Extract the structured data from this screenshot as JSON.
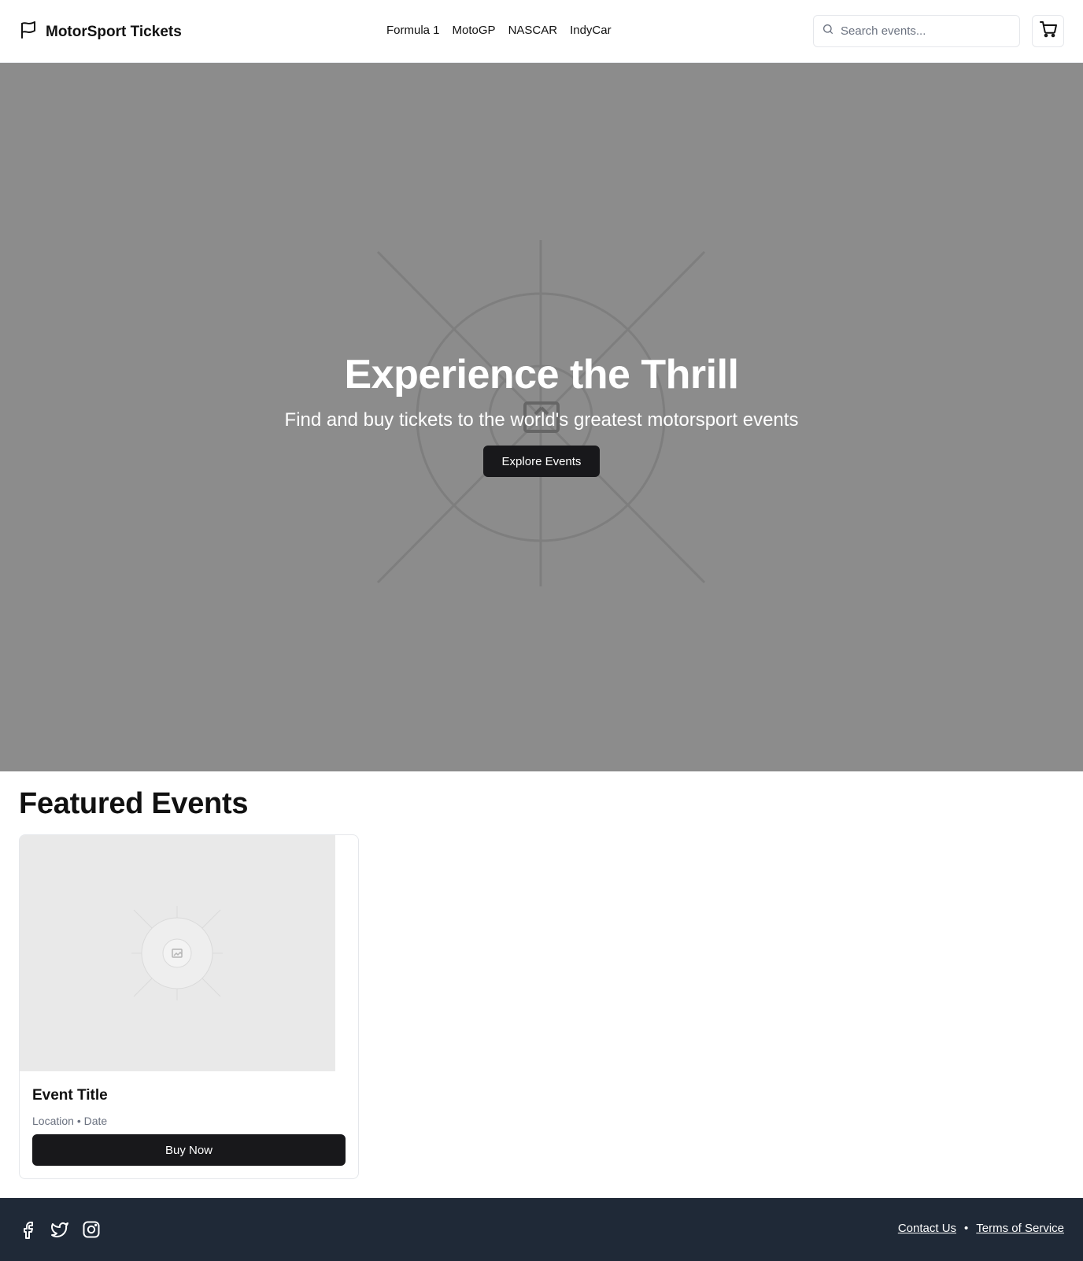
{
  "header": {
    "brand_name": "MotorSport Tickets",
    "brand_icon": "flag-icon",
    "nav": [
      "Formula 1",
      "MotoGP",
      "NASCAR",
      "IndyCar"
    ],
    "search_placeholder": "Search events...",
    "search_icon": "search-icon",
    "cart_icon": "cart-icon"
  },
  "hero": {
    "title": "Experience the Thrill",
    "subtitle": "Find and buy tickets to the world's greatest motorsport events",
    "button_label": "Explore Events",
    "background_color": "#8c8c8c"
  },
  "featured": {
    "title": "Featured Events",
    "events": [
      {
        "title": "Event Title",
        "meta": "Location • Date",
        "button_label": "Buy Now"
      }
    ]
  },
  "footer": {
    "social": [
      "facebook-icon",
      "twitter-icon",
      "instagram-icon"
    ],
    "links": [
      "Contact Us",
      "Terms of Service"
    ],
    "separator": "•",
    "background_color": "#1f2937"
  },
  "colors": {
    "primary_button": "#18181b",
    "border": "#e5e7eb",
    "muted_text": "#6b7280"
  }
}
